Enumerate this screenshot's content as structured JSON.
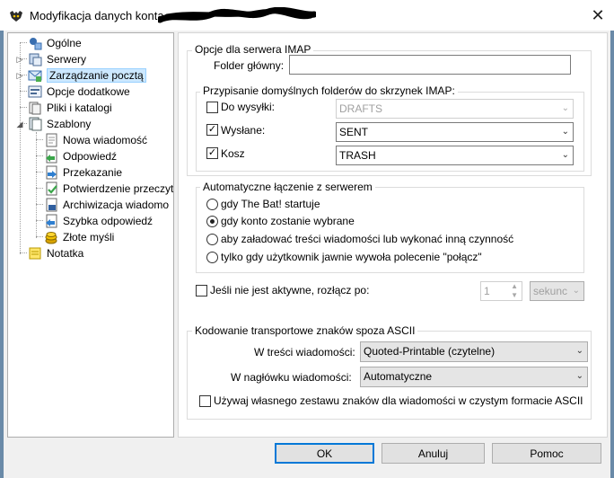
{
  "window": {
    "title": "Modyfikacja danych konta -",
    "close_glyph": "✕"
  },
  "tree": {
    "items": [
      {
        "label": "Ogólne",
        "icon": "general-settings-icon"
      },
      {
        "label": "Serwery",
        "icon": "servers-icon"
      },
      {
        "label": "Zarządzanie pocztą",
        "icon": "mail-management-icon"
      },
      {
        "label": "Opcje dodatkowe",
        "icon": "additional-options-icon"
      },
      {
        "label": "Pliki i katalogi",
        "icon": "files-folders-icon"
      },
      {
        "label": "Szablony",
        "icon": "templates-icon"
      },
      {
        "label": "Nowa wiadomość",
        "icon": "template-doc-icon"
      },
      {
        "label": "Odpowiedź",
        "icon": "reply-template-icon"
      },
      {
        "label": "Przekazanie",
        "icon": "forward-template-icon"
      },
      {
        "label": "Potwierdzenie przeczyt",
        "icon": "read-confirmation-icon"
      },
      {
        "label": "Archiwizacja wiadomo",
        "icon": "archive-template-icon"
      },
      {
        "label": "Szybka odpowiedź",
        "icon": "quick-reply-icon"
      },
      {
        "label": "Złote myśli",
        "icon": "coins-icon"
      },
      {
        "label": "Notatka",
        "icon": "note-icon"
      }
    ]
  },
  "imap": {
    "group_title": "Opcje dla serwera IMAP",
    "root_folder_label": "Folder główny:",
    "root_folder_value": "",
    "defaults_title": "Przypisanie domyślnych folderów do skrzynek IMAP:",
    "outbox_label": "Do wysyłki:",
    "outbox_value": "DRAFTS",
    "sent_label": "Wysłane:",
    "sent_value": "SENT",
    "trash_label": "Kosz",
    "trash_value": "TRASH",
    "check_mark": "✓"
  },
  "connect": {
    "group_title": "Automatyczne łączenie z serwerem",
    "options": [
      "gdy The Bat! startuje",
      "gdy konto zostanie wybrane",
      "aby załadować treści wiadomości lub wykonać inną czynność",
      "tylko gdy użytkownik jawnie wywoła polecenie \"połącz\""
    ],
    "selected_index": 1,
    "disconnect_label": "Jeśli nie jest aktywne, rozłącz po:",
    "disconnect_value": "1",
    "disconnect_unit": "sekunc"
  },
  "encoding": {
    "group_title": "Kodowanie transportowe znaków spoza ASCII",
    "body_label": "W treści wiadomości:",
    "body_value": "Quoted-Printable (czytelne)",
    "header_label": "W nagłówku wiadomości:",
    "header_value": "Automatyczne",
    "own_charset_label": "Używaj własnego zestawu znaków dla wiadomości w czystym formacie ASCII"
  },
  "buttons": {
    "ok": "OK",
    "cancel": "Anuluj",
    "help": "Pomoc"
  },
  "colors": {
    "selection": "#cce8ff",
    "default_button_border": "#0078d7"
  }
}
